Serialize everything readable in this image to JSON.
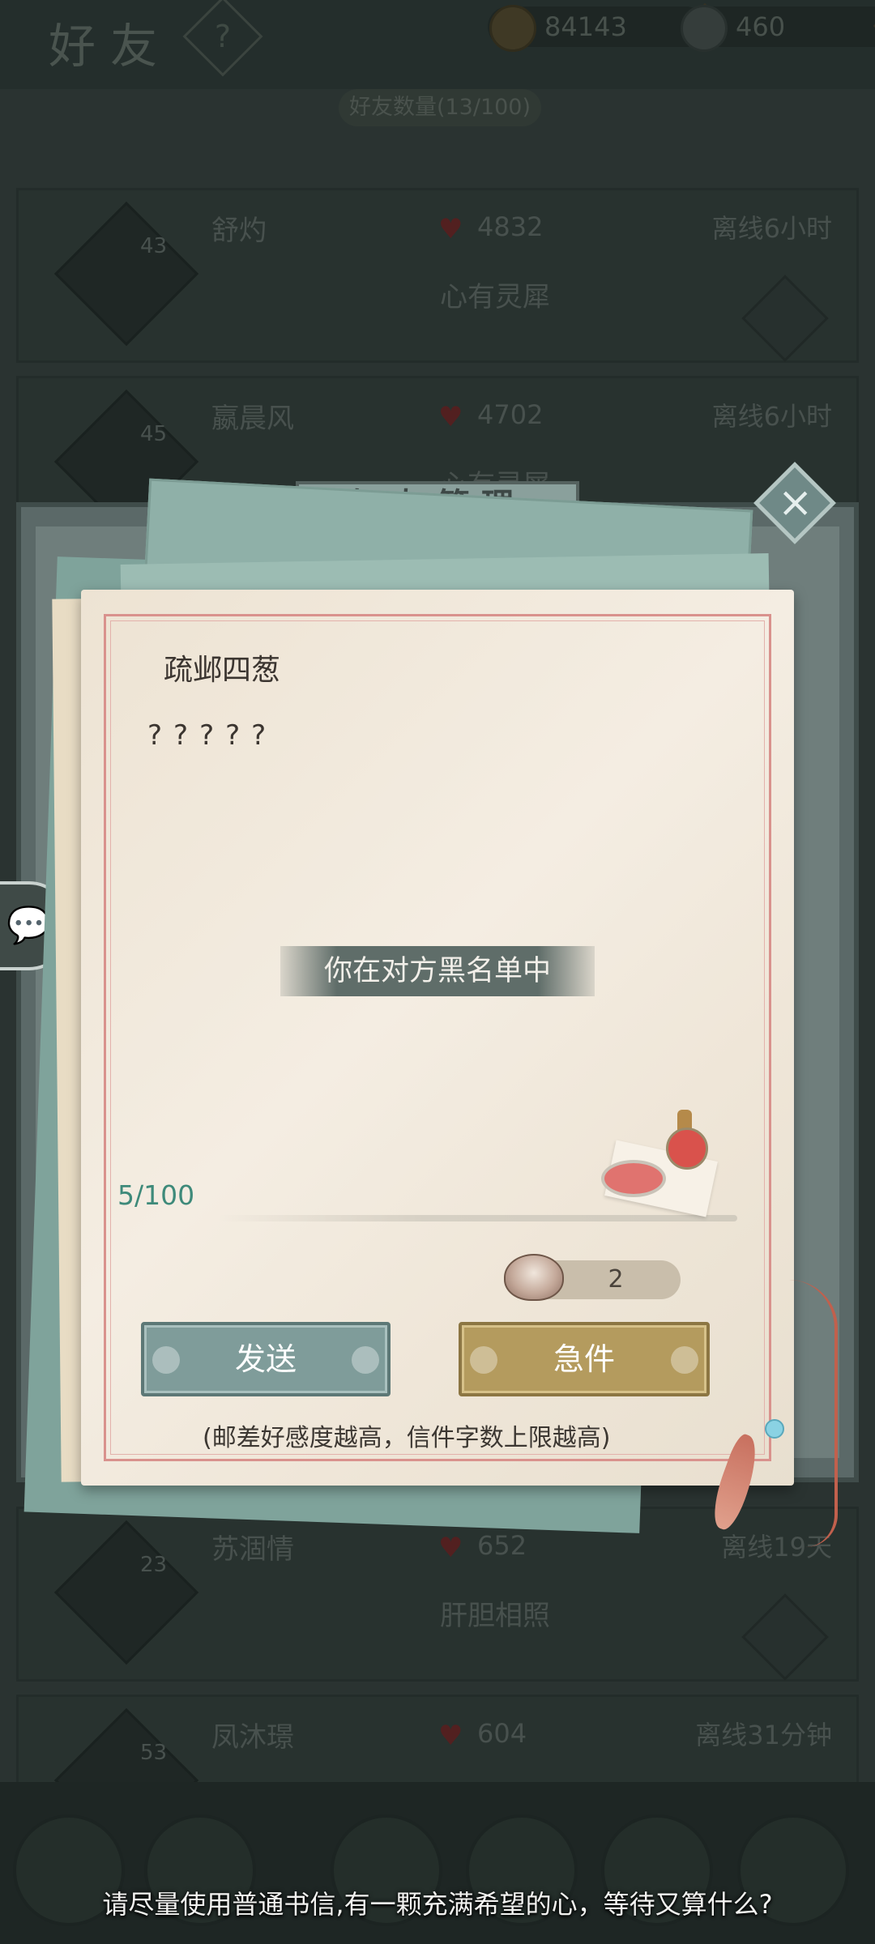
{
  "background": {
    "title": "好友",
    "help_label": "?",
    "currency_1": "84143",
    "currency_2": "460",
    "friend_count": "好友数量(13/100)",
    "friends": [
      {
        "level": "43",
        "name": "舒灼",
        "affinity": "4832",
        "status": "离线6小时",
        "relation": "心有灵犀"
      },
      {
        "level": "45",
        "name": "嬴晨风",
        "affinity": "4702",
        "status": "离线6小时",
        "relation": "心有灵犀"
      },
      {
        "level": "23",
        "name": "苏涸情",
        "affinity": "652",
        "status": "离线19天",
        "relation": "肝胆相照"
      },
      {
        "level": "53",
        "name": "凤沐璟",
        "affinity": "604",
        "status": "离线31分钟",
        "relation": ""
      }
    ]
  },
  "panel": {
    "title": "好友管理"
  },
  "letter": {
    "recipient": "疏邺四葱",
    "body": "?????",
    "notice": "你在对方黑名单中",
    "char_count": "5/100",
    "cost": "2",
    "send_label": "发送",
    "urgent_label": "急件",
    "hint": "(邮差好感度越高，信件字数上限越高)"
  },
  "subtitle": "请尽量使用普通书信,有一颗充满希望的心，等待又算什么?",
  "colors": {
    "send_button": "#7f9c9a",
    "urgent_button": "#b49b5e",
    "char_count": "#3e8a7a",
    "letter_border": "#d9928d"
  }
}
